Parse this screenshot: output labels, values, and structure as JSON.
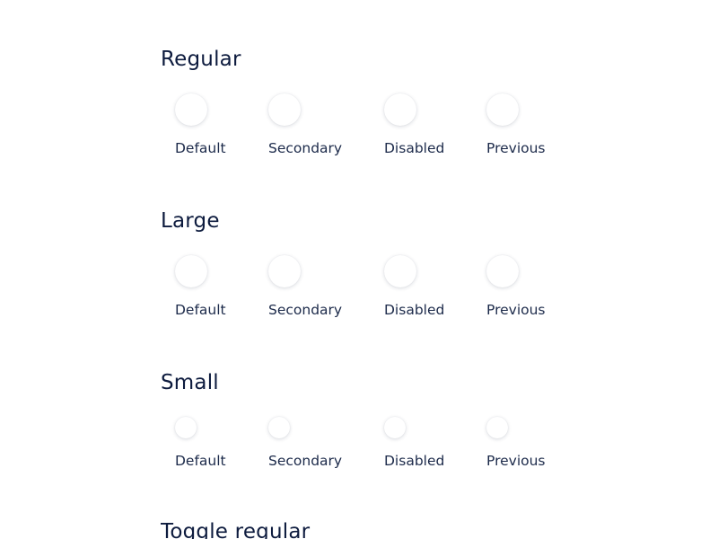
{
  "sections": [
    {
      "title": "Regular",
      "size": "regular",
      "buttons": [
        {
          "label": "Default"
        },
        {
          "label": "Secondary"
        },
        {
          "label": "Disabled"
        },
        {
          "label": "Previous"
        }
      ]
    },
    {
      "title": "Large",
      "size": "large",
      "buttons": [
        {
          "label": "Default"
        },
        {
          "label": "Secondary"
        },
        {
          "label": "Disabled"
        },
        {
          "label": "Previous"
        }
      ]
    },
    {
      "title": "Small",
      "size": "small",
      "buttons": [
        {
          "label": "Default"
        },
        {
          "label": "Secondary"
        },
        {
          "label": "Disabled"
        },
        {
          "label": "Previous"
        }
      ]
    },
    {
      "title": "Toggle regular",
      "size": "toggle",
      "buttons": []
    }
  ],
  "colors": {
    "heading": "#0d1b3e",
    "label": "#1c2a4a",
    "background": "#ffffff",
    "button": "#ffffff"
  }
}
